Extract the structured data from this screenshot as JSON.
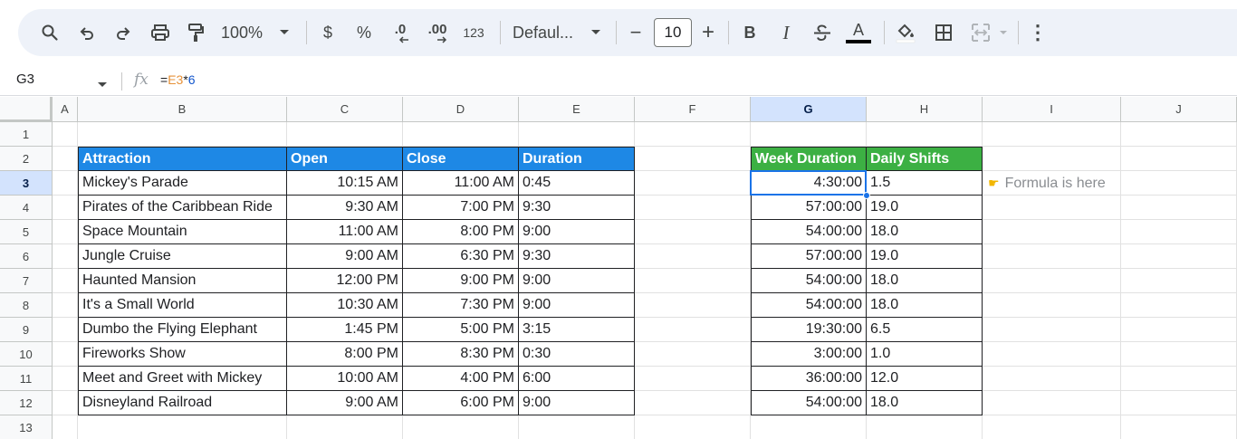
{
  "toolbar": {
    "zoom": "100%",
    "currency": "$",
    "percent": "%",
    "decrease_decimal": ".0",
    "increase_decimal": ".00",
    "number_format": "123",
    "font": "Defaul...",
    "font_size": "10",
    "minus": "−",
    "plus": "+",
    "bold": "B",
    "italic": "I",
    "text_color_letter": "A",
    "more": "⋮"
  },
  "formula_bar": {
    "name_box": "G3",
    "fx": "fx",
    "formula_prefix": "=",
    "formula_ref": "E3",
    "formula_op": "*",
    "formula_num": "6"
  },
  "grid": {
    "columns": [
      "A",
      "B",
      "C",
      "D",
      "E",
      "F",
      "G",
      "H",
      "I",
      "J"
    ],
    "rows": [
      "1",
      "2",
      "3",
      "4",
      "5",
      "6",
      "7",
      "8",
      "9",
      "10",
      "11",
      "12",
      "13"
    ],
    "selected_column": "G",
    "selected_row": "3"
  },
  "table1": {
    "headers": [
      "Attraction",
      "Open",
      "Close",
      "Duration"
    ],
    "rows": [
      [
        "Mickey's Parade",
        "10:15 AM",
        "11:00 AM",
        "0:45"
      ],
      [
        "Pirates of the Caribbean Ride",
        "9:30 AM",
        "7:00 PM",
        "9:30"
      ],
      [
        "Space Mountain",
        "11:00 AM",
        "8:00 PM",
        "9:00"
      ],
      [
        "Jungle Cruise",
        "9:00 AM",
        "6:30 PM",
        "9:30"
      ],
      [
        "Haunted Mansion",
        "12:00 PM",
        "9:00 PM",
        "9:00"
      ],
      [
        "It's a Small World",
        "10:30 AM",
        "7:30 PM",
        "9:00"
      ],
      [
        "Dumbo the Flying Elephant",
        "1:45 PM",
        "5:00 PM",
        "3:15"
      ],
      [
        "Fireworks Show",
        "8:00 PM",
        "8:30 PM",
        "0:30"
      ],
      [
        "Meet and Greet with Mickey",
        "10:00 AM",
        "4:00 PM",
        "6:00"
      ],
      [
        "Disneyland Railroad",
        "9:00 AM",
        "6:00 PM",
        "9:00"
      ]
    ]
  },
  "table2": {
    "headers": [
      "Week Duration",
      "Daily Shifts"
    ],
    "rows": [
      [
        "4:30:00",
        "1.5"
      ],
      [
        "57:00:00",
        "19.0"
      ],
      [
        "54:00:00",
        "18.0"
      ],
      [
        "57:00:00",
        "19.0"
      ],
      [
        "54:00:00",
        "18.0"
      ],
      [
        "54:00:00",
        "18.0"
      ],
      [
        "19:30:00",
        "6.5"
      ],
      [
        "3:00:00",
        "1.0"
      ],
      [
        "36:00:00",
        "12.0"
      ],
      [
        "54:00:00",
        "18.0"
      ]
    ]
  },
  "annotation": {
    "icon": "pointing-hand-icon",
    "text": "Formula is here"
  },
  "colors": {
    "header_blue": "#1e88e5",
    "header_green": "#3cb043",
    "selection": "#1a73e8",
    "formula_ref": "#e69138",
    "formula_number": "#1155cc"
  }
}
